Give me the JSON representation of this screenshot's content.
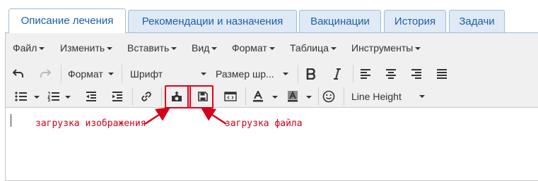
{
  "tabs": [
    {
      "label": "Описание лечения",
      "active": true
    },
    {
      "label": "Рекомендации и назначения",
      "active": false
    },
    {
      "label": "Вакцинации",
      "active": false
    },
    {
      "label": "История",
      "active": false
    },
    {
      "label": "Задачи",
      "active": false
    }
  ],
  "menu": [
    "Файл",
    "Изменить",
    "Вставить",
    "Вид",
    "Формат",
    "Таблица",
    "Инструменты"
  ],
  "toolbar": {
    "format_label": "Формат",
    "font_label": "Шрифт",
    "font_size_label": "Размер шр...",
    "line_height_label": "Line Height"
  },
  "annotations": {
    "image_upload": "загрузка изображения",
    "file_upload": "загрузка файла"
  },
  "colors": {
    "tab_text": "#1f5ea8",
    "tab_bg": "#dfeaf6",
    "tab_border": "#9ebcd8",
    "highlight": "#e3001b"
  },
  "icons": [
    "undo-icon",
    "redo-icon",
    "bold-icon",
    "italic-icon",
    "align-left-icon",
    "align-center-icon",
    "align-right-icon",
    "align-justify-icon",
    "bullet-list-icon",
    "numbered-list-icon",
    "outdent-icon",
    "indent-icon",
    "link-icon",
    "upload-image-icon",
    "save-file-icon",
    "code-icon",
    "text-color-icon",
    "background-color-icon",
    "emoticon-icon"
  ]
}
